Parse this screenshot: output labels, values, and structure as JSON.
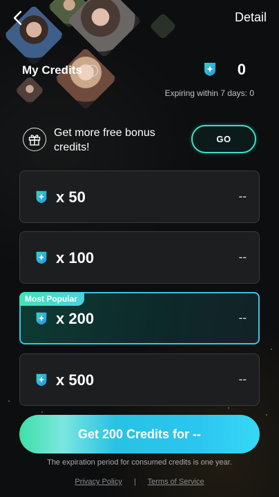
{
  "header": {
    "detail_label": "Detail"
  },
  "credits": {
    "label": "My Credits",
    "balance": "0",
    "expiring": "Expiring within 7 days: 0"
  },
  "bonus": {
    "text": "Get more free bonus credits!",
    "go_label": "GO"
  },
  "packages": [
    {
      "amount": "x 50",
      "price": "--"
    },
    {
      "amount": "x 100",
      "price": "--"
    },
    {
      "amount": "x 200",
      "price": "--",
      "badge": "Most Popular"
    },
    {
      "amount": "x 500",
      "price": "--"
    }
  ],
  "cta": {
    "label": "Get 200 Credits for --"
  },
  "footer": {
    "expiration_note": "The expiration period for consumed credits is one year.",
    "privacy": "Privacy Policy",
    "separator": "|",
    "terms": "Terms of Service"
  },
  "colors": {
    "accent_teal": "#3fe0c6",
    "accent_blue": "#35c8e6",
    "background": "#0d0e0f"
  },
  "icons": {
    "back": "chevron-left-icon",
    "info": "info-icon",
    "credit": "credit-gem-icon",
    "gift": "gift-icon"
  },
  "selected_package_index": 2
}
